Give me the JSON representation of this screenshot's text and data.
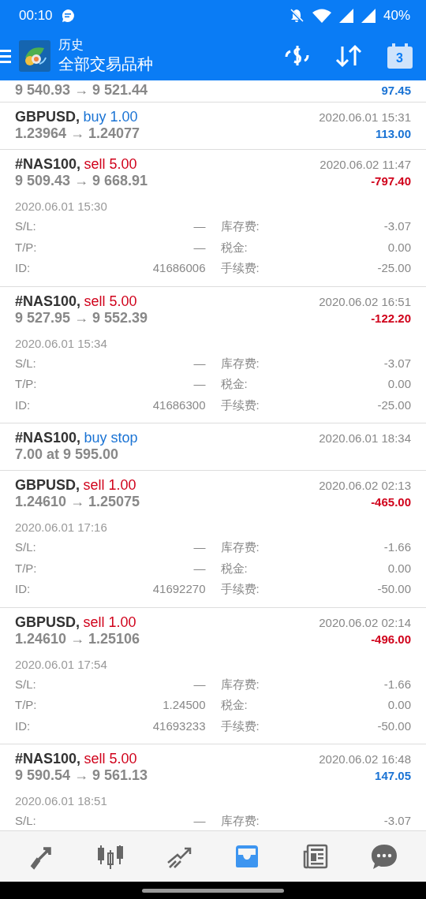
{
  "status_bar": {
    "time": "00:10",
    "battery": "40%"
  },
  "header": {
    "title": "历史",
    "subtitle": "全部交易品种",
    "calendar_day": "3"
  },
  "rows": [
    {
      "prices": "9 540.93 → 9 521.44",
      "profit": "97.45",
      "loss": false
    },
    {
      "symbol": "GBPUSD,",
      "color": "#1a73d4",
      "deal": "buy 1.00",
      "time": "2020.06.01 15:31",
      "prices": "1.23964 → 1.24077",
      "profit": "113.00",
      "loss": false
    },
    {
      "symbol": "#NAS100,",
      "color": "#d0021b",
      "deal": "sell 5.00",
      "time": "2020.06.02 11:47",
      "prices": "9 509.43 → 9 668.91",
      "profit": "-797.40",
      "loss": true,
      "open_time": "2020.06.01 15:30",
      "details": [
        {
          "label": "S/L:",
          "value": "—",
          "label2": "库存费:",
          "value2": "-3.07"
        },
        {
          "label": "T/P:",
          "value": "—",
          "label2": "税金:",
          "value2": "0.00"
        },
        {
          "label": "ID:",
          "value": "41686006",
          "label2": "手续费:",
          "value2": "-25.00"
        }
      ]
    },
    {
      "symbol": "#NAS100,",
      "color": "#d0021b",
      "deal": "sell 5.00",
      "time": "2020.06.02 16:51",
      "prices": "9 527.95 → 9 552.39",
      "profit": "-122.20",
      "loss": true,
      "open_time": "2020.06.01 15:34",
      "details": [
        {
          "label": "S/L:",
          "value": "—",
          "label2": "库存费:",
          "value2": "-3.07"
        },
        {
          "label": "T/P:",
          "value": "—",
          "label2": "税金:",
          "value2": "0.00"
        },
        {
          "label": "ID:",
          "value": "41686300",
          "label2": "手续费:",
          "value2": "-25.00"
        }
      ]
    },
    {
      "symbol": "#NAS100,",
      "color": "#1a73d4",
      "deal": "buy stop",
      "time": "2020.06.01 18:34",
      "prices": "7.00 at 9 595.00"
    },
    {
      "symbol": "GBPUSD,",
      "color": "#d0021b",
      "deal": "sell 1.00",
      "time": "2020.06.02 02:13",
      "prices": "1.24610 → 1.25075",
      "profit": "-465.00",
      "loss": true,
      "open_time": "2020.06.01 17:16",
      "details": [
        {
          "label": "S/L:",
          "value": "—",
          "label2": "库存费:",
          "value2": "-1.66"
        },
        {
          "label": "T/P:",
          "value": "—",
          "label2": "税金:",
          "value2": "0.00"
        },
        {
          "label": "ID:",
          "value": "41692270",
          "label2": "手续费:",
          "value2": "-50.00"
        }
      ]
    },
    {
      "symbol": "GBPUSD,",
      "color": "#d0021b",
      "deal": "sell 1.00",
      "time": "2020.06.02 02:14",
      "prices": "1.24610 → 1.25106",
      "profit": "-496.00",
      "loss": true,
      "open_time": "2020.06.01 17:54",
      "details": [
        {
          "label": "S/L:",
          "value": "—",
          "label2": "库存费:",
          "value2": "-1.66"
        },
        {
          "label": "T/P:",
          "value": "1.24500",
          "label2": "税金:",
          "value2": "0.00"
        },
        {
          "label": "ID:",
          "value": "41693233",
          "label2": "手续费:",
          "value2": "-50.00"
        }
      ]
    },
    {
      "symbol": "#NAS100,",
      "color": "#d0021b",
      "deal": "sell 5.00",
      "time": "2020.06.02 16:48",
      "prices": "9 590.54 → 9 561.13",
      "profit": "147.05",
      "loss": false,
      "open_time": "2020.06.01 18:51",
      "details": [
        {
          "label": "S/L:",
          "value": "—",
          "label2": "库存费:",
          "value2": "-3.07"
        }
      ]
    }
  ],
  "bottom_nav": [
    {
      "kind": "trade",
      "selected": false
    },
    {
      "kind": "chart",
      "selected": false
    },
    {
      "kind": "trend",
      "selected": false
    },
    {
      "kind": "history",
      "selected": true
    },
    {
      "kind": "news",
      "selected": false
    },
    {
      "kind": "chat",
      "selected": false
    }
  ]
}
